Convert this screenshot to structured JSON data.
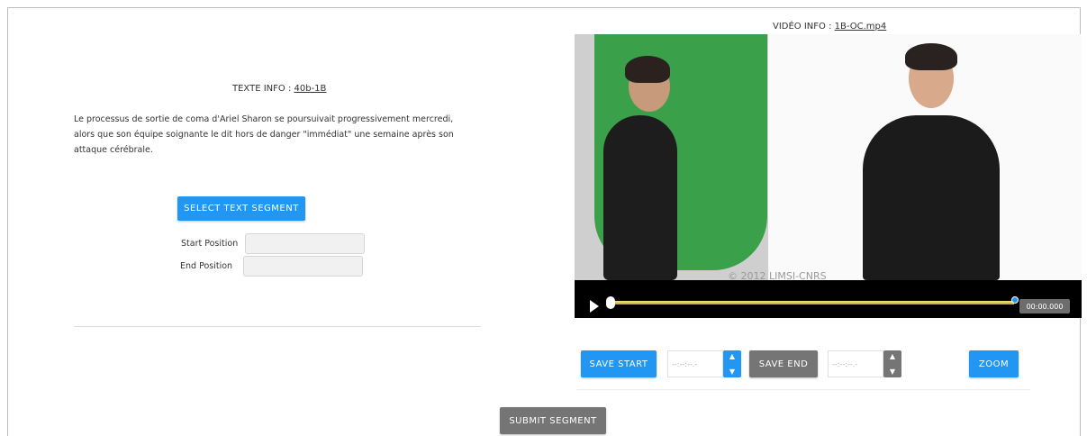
{
  "text_info": {
    "label": "TEXTE INFO :",
    "id": "40b-1B"
  },
  "text_body": "Le processus de sortie de coma d'Ariel Sharon se poursuivait progressivement mercredi, alors que son équipe soignante le dit hors de danger \"immédiat\" une semaine après son attaque cérébrale.",
  "select_text_segment": "SELECT TEXT SEGMENT",
  "start_position_label": "Start Position",
  "end_position_label": "End Position",
  "video_info": {
    "label": "VIDÉO INFO :",
    "file": "1B-OC.mp4"
  },
  "video": {
    "watermark": "© 2012 LIMSI-CNRS",
    "time": "00:00.000"
  },
  "controls": {
    "save_start": "SAVE START",
    "save_end": "SAVE END",
    "zoom": "ZOOM",
    "start_time_placeholder": "--:--:--.-",
    "end_time_placeholder": "--:--:--.-",
    "spin_up": "▲",
    "spin_down": "▼"
  },
  "submit_segment": "SUBMIT SEGMENT",
  "colors": {
    "primary": "#2196f3",
    "secondary": "#757575"
  }
}
